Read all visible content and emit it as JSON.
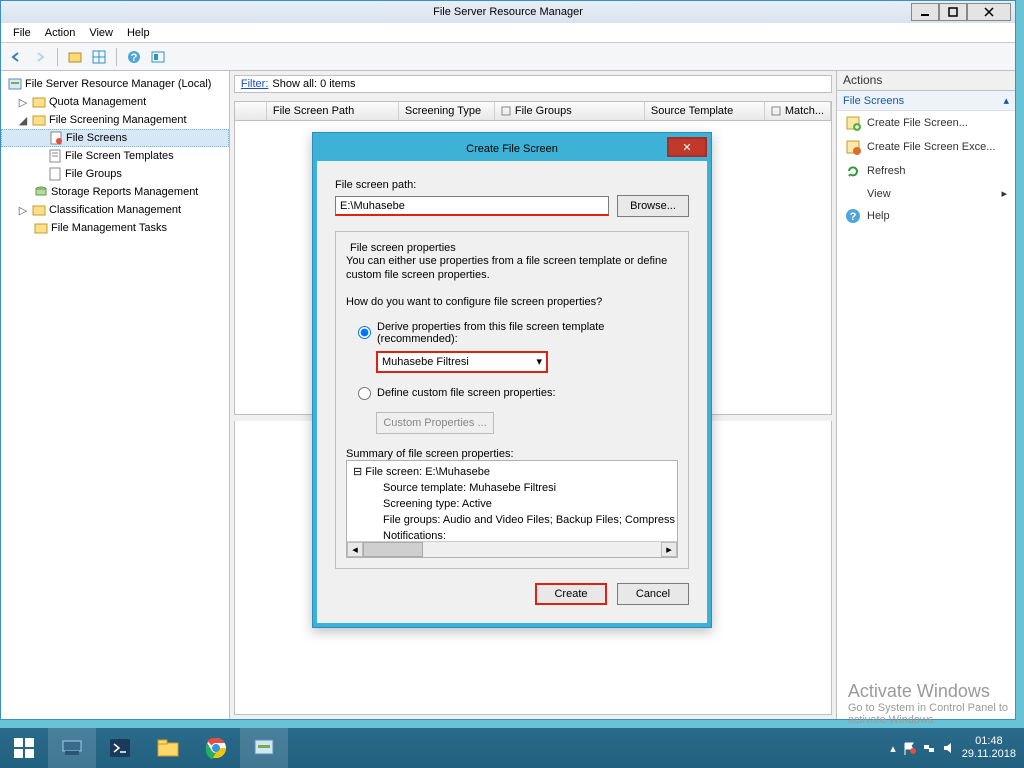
{
  "window": {
    "title": "File Server Resource Manager",
    "menu": [
      "File",
      "Action",
      "View",
      "Help"
    ]
  },
  "tree": {
    "root": "File Server Resource Manager (Local)",
    "quota": "Quota Management",
    "screen_mgmt": "File Screening Management",
    "file_screens": "File Screens",
    "templates": "File Screen Templates",
    "file_groups": "File Groups",
    "reports": "Storage Reports Management",
    "classification": "Classification Management",
    "tasks": "File Management Tasks"
  },
  "filter": {
    "label": "Filter:",
    "text": "Show all: 0 items"
  },
  "grid": {
    "cols": [
      "File Screen Path",
      "Screening Type",
      "File Groups",
      "Source Template",
      "Match..."
    ]
  },
  "actions": {
    "title": "Actions",
    "section": "File Screens",
    "items": [
      "Create File Screen...",
      "Create File Screen Exce...",
      "Refresh",
      "View",
      "Help"
    ]
  },
  "dialog": {
    "title": "Create File Screen",
    "path_label": "File screen path:",
    "path_value": "E:\\Muhasebe",
    "browse": "Browse...",
    "fs_props": "File screen properties",
    "info": "You can either use properties from a file screen template or define custom file screen properties.",
    "question": "How do you want to configure file screen properties?",
    "radio1": "Derive properties from this file screen template (recommended):",
    "template": "Muhasebe Filtresi",
    "radio2": "Define custom file screen properties:",
    "custom_btn": "Custom Properties ...",
    "summary_label": "Summary of file screen properties:",
    "summary": {
      "root": "File screen: E:\\Muhasebe",
      "source": "Source template: Muhasebe Filtresi",
      "type": "Screening type: Active",
      "groups": "File groups: Audio and Video Files; Backup Files; Compress",
      "notif": "Notifications:"
    },
    "create": "Create",
    "cancel": "Cancel"
  },
  "watermark": {
    "line1": "Activate Windows",
    "line2": "Go to System in Control Panel to",
    "line3": "activate Windows."
  },
  "taskbar": {
    "time": "01:48",
    "date": "29.11.2018"
  }
}
